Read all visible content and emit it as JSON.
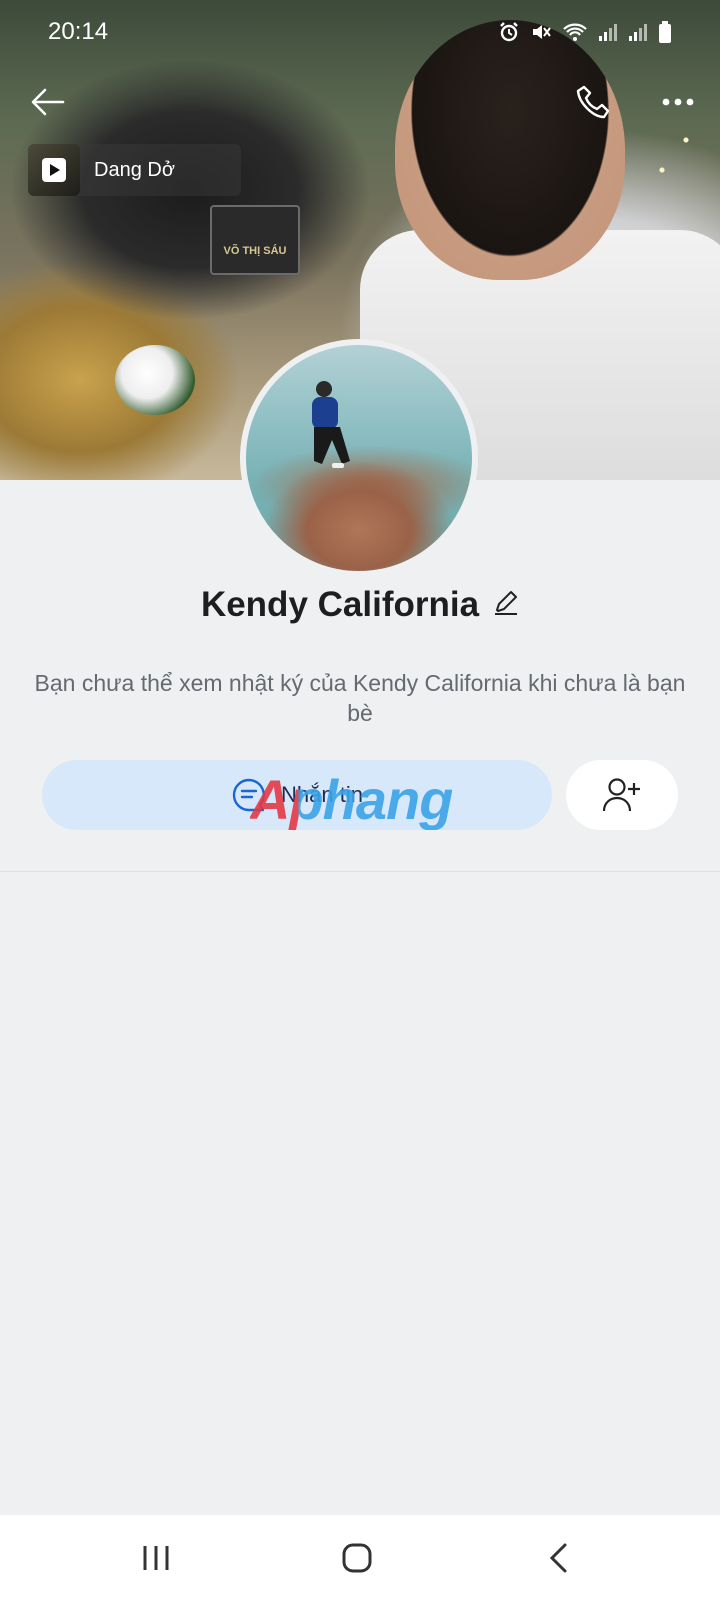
{
  "status_bar": {
    "time": "20:14",
    "icons": [
      "alarm-icon",
      "mute-icon",
      "wifi-icon",
      "signal-icon",
      "signal-icon",
      "battery-icon"
    ]
  },
  "header": {
    "back_icon": "arrow-left-icon",
    "call_icon": "phone-icon",
    "more_icon": "more-dots-icon"
  },
  "music": {
    "title": "Dang Dở",
    "icon": "play-icon"
  },
  "cover": {
    "plate_text": "VÕ THỊ SÁU"
  },
  "profile": {
    "name": "Kendy California",
    "edit_icon": "pencil-icon",
    "privacy_note": "Bạn chưa thể xem nhật ký của Kendy California khi chưa là bạn bè"
  },
  "actions": {
    "message_label": "Nhắn tin",
    "message_icon": "chat-icon",
    "add_friend_icon": "add-user-icon"
  },
  "watermark": "Aphang",
  "nav_bar": {
    "recent_icon": "recent-apps-icon",
    "home_icon": "home-icon",
    "back_icon": "chevron-left-icon"
  },
  "colors": {
    "background": "#eef0f2",
    "message_button_bg": "#d8e8fb",
    "accent_blue": "#1a66d6",
    "note_text": "#666a70"
  }
}
